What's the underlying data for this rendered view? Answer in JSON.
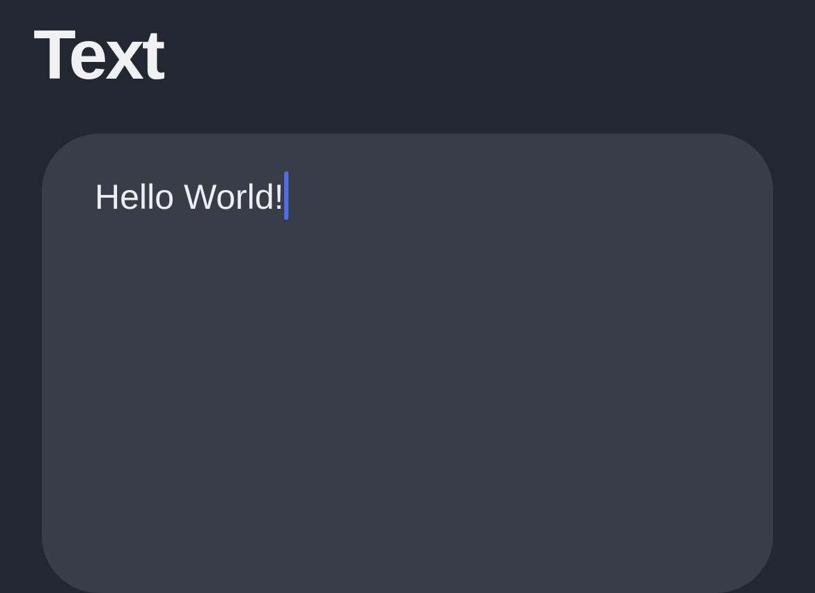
{
  "header": {
    "title": "Text"
  },
  "editor": {
    "content": "Hello World!",
    "caret_color": "#4f6cf0",
    "background_color": "#393d47"
  },
  "theme": {
    "page_background": "#222731",
    "title_color": "#f1f1f3"
  }
}
